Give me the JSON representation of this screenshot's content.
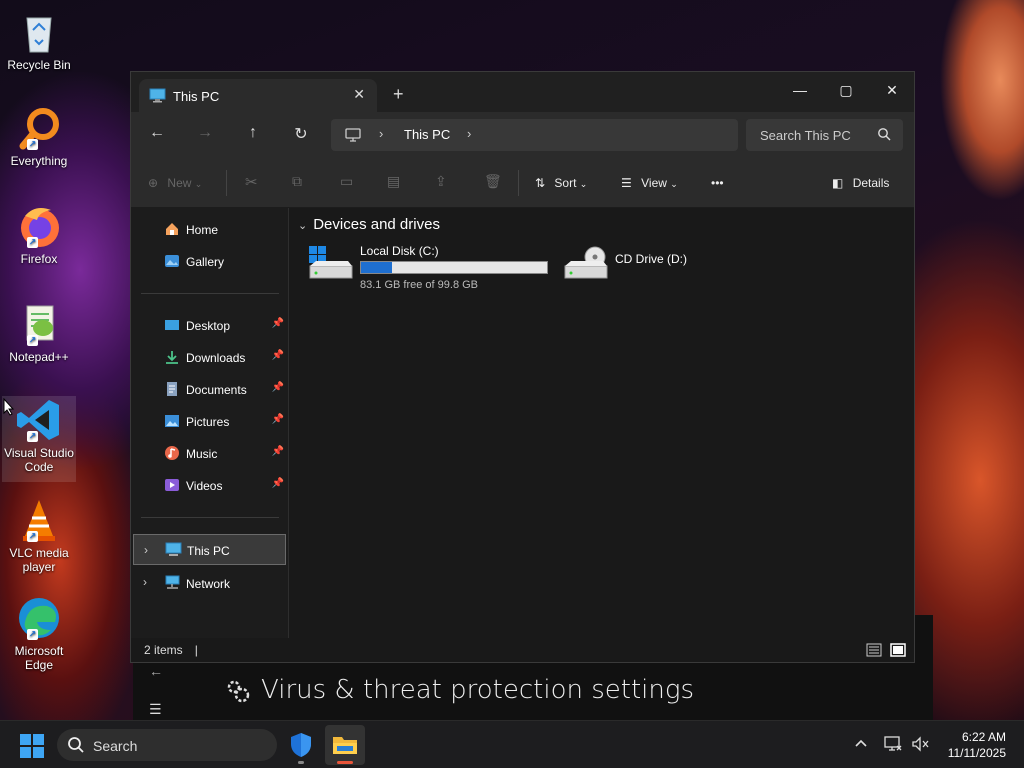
{
  "desktop": {
    "icons": [
      {
        "label": "Recycle Bin"
      },
      {
        "label": "Everything"
      },
      {
        "label": "Firefox"
      },
      {
        "label": "Notepad++"
      },
      {
        "label": "Visual Studio Code"
      },
      {
        "label": "VLC media player"
      },
      {
        "label": "Microsoft Edge"
      }
    ]
  },
  "defender": {
    "back_icon": "←",
    "menu_icon": "☰",
    "title": "Virus & threat protection settings"
  },
  "explorer": {
    "tab_title": "This PC",
    "tab_close": "✕",
    "new_tab": "+",
    "window_controls": {
      "minimize": "—",
      "maximize": "▢",
      "close": "✕"
    },
    "nav": {
      "back": "←",
      "forward": "→",
      "up": "↑",
      "refresh": "↻"
    },
    "address": {
      "chevron": "›",
      "crumb": "This PC"
    },
    "search_placeholder": "Search This PC",
    "commands": {
      "new_label": "New",
      "sort_label": "Sort",
      "view_label": "View",
      "more_label": "•••",
      "details_label": "Details"
    },
    "sidebar": {
      "quick": [
        {
          "label": "Home"
        },
        {
          "label": "Gallery"
        }
      ],
      "pinned": [
        {
          "label": "Desktop"
        },
        {
          "label": "Downloads"
        },
        {
          "label": "Documents"
        },
        {
          "label": "Pictures"
        },
        {
          "label": "Music"
        },
        {
          "label": "Videos"
        }
      ],
      "tree": [
        {
          "label": "This PC",
          "selected": true
        },
        {
          "label": "Network",
          "selected": false
        }
      ]
    },
    "group_title": "Devices and drives",
    "drives": [
      {
        "name": "Local Disk (C:)",
        "free_text": "83.1 GB free of 99.8 GB",
        "used_fraction": 0.167
      },
      {
        "name": "CD Drive (D:)"
      }
    ],
    "status": {
      "items": "2 items",
      "cursor": "|"
    }
  },
  "taskbar": {
    "search_placeholder": "Search",
    "tray_chevron": "^",
    "time": "6:22 AM",
    "date": "11/11/2025"
  },
  "colors": {
    "accent": "#1e6fd0",
    "window_bg": "#191919",
    "taskbar_bg": "#1d1d1f"
  }
}
